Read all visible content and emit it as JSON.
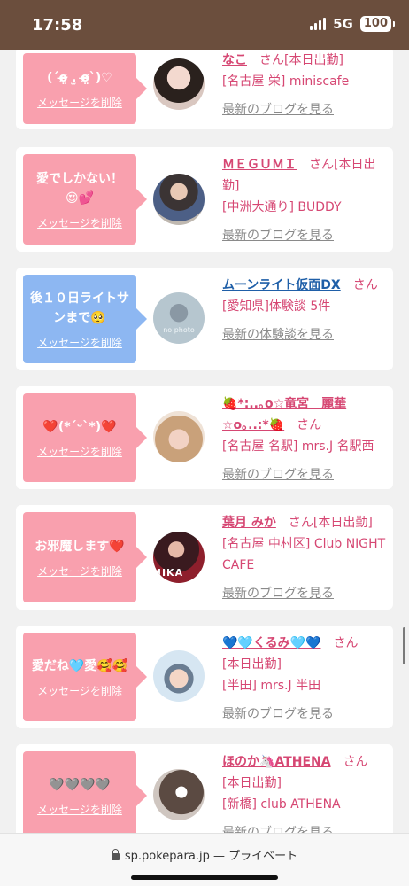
{
  "status": {
    "time": "17:58",
    "network": "5G",
    "battery": "100"
  },
  "colors": {
    "status_bg": "#6b4e3d",
    "pink_bubble": "#f9a0ae",
    "blue_bubble": "#8db7f2",
    "name_pink": "#d64773",
    "name_blue": "#1f5fa8"
  },
  "cards": [
    {
      "message": "(ˊo̴̶̷̤ .̫ o̴̶̷̤ˋ)♡",
      "delete_label": "メッセージを削除",
      "name": "なこ",
      "san": "さん",
      "lines": [
        "[本日出勤]",
        "[名古屋 栄] miniscafe"
      ],
      "link": "最新のブログを見る"
    },
    {
      "message": "愛でしかない！😍💕",
      "delete_label": "メッセージを削除",
      "name": "ＭＥＧＵＭＩ",
      "san": "さん",
      "lines": [
        "[本日出勤]",
        "[中洲大通り] BUDDY"
      ],
      "link": "最新のブログを見る"
    },
    {
      "message": "後１０日ライトサンまで🥺",
      "delete_label": "メッセージを削除",
      "name": "ムーンライト仮面DX",
      "san": "さん",
      "lines": [
        "[愛知県]体験談 5件"
      ],
      "link": "最新の体験談を見る",
      "avatar_text": "no photo"
    },
    {
      "message": "❤️(*ˊᵕˋ*)❤️",
      "delete_label": "メッセージを削除",
      "name": "🍓*:..｡o☆竜宮　麗華☆o｡..:*🍓",
      "san": "さん",
      "lines": [
        "[名古屋 名駅] mrs.J 名駅西"
      ],
      "link": "最新のブログを見る"
    },
    {
      "message": "お邪魔します❤️",
      "delete_label": "メッセージを削除",
      "name": "葉月 みか",
      "san": "さん",
      "lines": [
        "[本日出勤]",
        "[名古屋 中村区] Club NIGHT CAFE"
      ],
      "link": "最新のブログを見る",
      "avatar_text": "MIKA"
    },
    {
      "message": "愛だね🩵愛🥰🥰",
      "delete_label": "メッセージを削除",
      "name": "💙🩵くるみ🩵💙",
      "san": "さん",
      "lines": [
        "[本日出勤]",
        "[半田] mrs.J 半田"
      ],
      "link": "最新のブログを見る"
    },
    {
      "message": "🩶🩶🩶🩶",
      "delete_label": "メッセージを削除",
      "name": "ほのか🦄ATHENA",
      "san": "さん",
      "lines": [
        "[本日出勤]",
        "[新橋] club ATHENA"
      ],
      "link": "最新のブログを見る"
    }
  ],
  "urlbar": {
    "domain": "sp.pokepara.jp",
    "separator": "—",
    "mode": "プライベート"
  }
}
